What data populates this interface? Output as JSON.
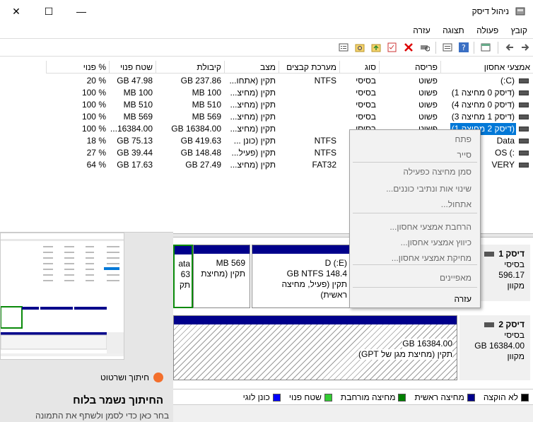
{
  "window": {
    "title": "ניהול דיסק",
    "close_glyph": "✕",
    "maximize_glyph": "☐",
    "minimize_glyph": "—"
  },
  "menu": [
    "קובץ",
    "פעולה",
    "תצוגה",
    "עזרה"
  ],
  "volume_list": {
    "headers": {
      "volume": "אמצעי אחסון",
      "layout": "פריסה",
      "type": "סוג",
      "filesystem": "מערכת קבצים",
      "status": "מצב",
      "capacity": "קיבולת",
      "free": "שטח פנוי",
      "pct_free": "% פנוי"
    },
    "rows": [
      {
        "volume": "(C:)",
        "layout": "פשוט",
        "type": "בסיסי",
        "filesystem": "NTFS",
        "status": "תקין (אתחו...",
        "capacity": "GB 237.86",
        "free": "GB 47.98",
        "pct_free": "% 20"
      },
      {
        "volume": "(דיסק 0 מחיצה 1)",
        "layout": "פשוט",
        "type": "בסיסי",
        "filesystem": "",
        "status": "תקין (מחיצ...",
        "capacity": "MB 100",
        "free": "MB 100",
        "pct_free": "% 100"
      },
      {
        "volume": "(דיסק 0 מחיצה 4)",
        "layout": "פשוט",
        "type": "בסיסי",
        "filesystem": "",
        "status": "תקין (מחיצ...",
        "capacity": "MB 510",
        "free": "MB 510",
        "pct_free": "% 100"
      },
      {
        "volume": "(דיסק 1 מחיצה 3)",
        "layout": "פשוט",
        "type": "בסיסי",
        "filesystem": "",
        "status": "תקין (מחיצ...",
        "capacity": "MB 569",
        "free": "MB 569",
        "pct_free": "% 100"
      },
      {
        "volume": "(דיסק 2 מחיצה 1)",
        "layout": "פשוט",
        "type": "בסיסי",
        "filesystem": "",
        "status": "תקין (מחיצ...",
        "capacity": "GB 16384.00",
        "free": "16384.00...",
        "pct_free": "% 100"
      },
      {
        "volume": "Data (E:)",
        "layout": "",
        "type": "",
        "filesystem": "NTFS",
        "status": "תקין (כונן ...",
        "capacity": "GB 419.63",
        "free": "GB 75.13",
        "pct_free": "% 18"
      },
      {
        "volume": "OS (D:)",
        "layout": "",
        "type": "",
        "filesystem": "NTFS",
        "status": "תקין (פעיל...",
        "capacity": "GB 148.48",
        "free": "GB 39.44",
        "pct_free": "% 27"
      },
      {
        "volume": "RECOVERY",
        "layout": "",
        "type": "",
        "filesystem": "FAT32",
        "status": "תקין (מחיצ...",
        "capacity": "GB 27.49",
        "free": "GB 17.63",
        "pct_free": "% 64"
      }
    ],
    "visible_row_volumes": [
      "(C:)",
      "(דיסק 0 מחיצה 1)",
      "(דיסק 0 מחיצה 4)",
      "(דיסק 1 מחיצה 3)",
      "(דיסק 2 מחיצה 1)",
      "Data",
      ":) OS",
      "VERY"
    ]
  },
  "context_menu": {
    "items": [
      {
        "label": "פתח",
        "enabled": false
      },
      {
        "label": "סייר",
        "enabled": false
      },
      {
        "label": "סמן מחיצה כפעילה",
        "enabled": false
      },
      {
        "label": "שינוי אות ונתיבי כוננים...",
        "enabled": false
      },
      {
        "label": "אתחול...",
        "enabled": false
      },
      {
        "label": "הרחבת אמצעי אחסון...",
        "enabled": false
      },
      {
        "label": "כיווץ אמצעי אחסון...",
        "enabled": false
      },
      {
        "label": "מחיקת אמצעי אחסון...",
        "enabled": false
      },
      {
        "label": "מאפיינים",
        "enabled": false
      },
      {
        "label": "עזרה",
        "enabled": true
      }
    ]
  },
  "graph": {
    "disk1": {
      "name": "דיסק 1",
      "type": "בסיסי",
      "size": "596.17",
      "status": "מקוון",
      "parts": [
        {
          "line1": "ata",
          "line2": "63",
          "line3": "תק"
        },
        {
          "line1": "",
          "line2": "MB 569",
          "line3": "תקין (מחיצת"
        },
        {
          "line1": "(E:) D",
          "line2": "GB NTFS 148.4",
          "line3": "תקין (פעיל, מחיצה ראשית)"
        }
      ]
    },
    "disk2": {
      "name": "דיסק 2",
      "type": "בסיסי",
      "size": "GB 16384.00",
      "status": "מקוון",
      "part": {
        "line1": "GB 16384.00",
        "line2": "תקין (מחיצת מגן של GPT)"
      }
    }
  },
  "legend": [
    {
      "label": "לא הוקצה",
      "color": "#000000"
    },
    {
      "label": "מחיצה ראשית",
      "color": "#00008b"
    },
    {
      "label": "מחיצה מורחבת",
      "color": "#008000"
    },
    {
      "label": "שטח פנוי",
      "color": "#33cc33"
    },
    {
      "label": "כונן לוגי",
      "color": "#0000ff"
    }
  ],
  "toast": {
    "app_name": "חיתוך ושרטוט",
    "title": "החיתוך נשמר בלוח",
    "body": "בחר כאן כדי לסמן ולשתף את התמונה"
  },
  "colors": {
    "selection": "#0078d7",
    "primary_partition": "#00008b"
  }
}
